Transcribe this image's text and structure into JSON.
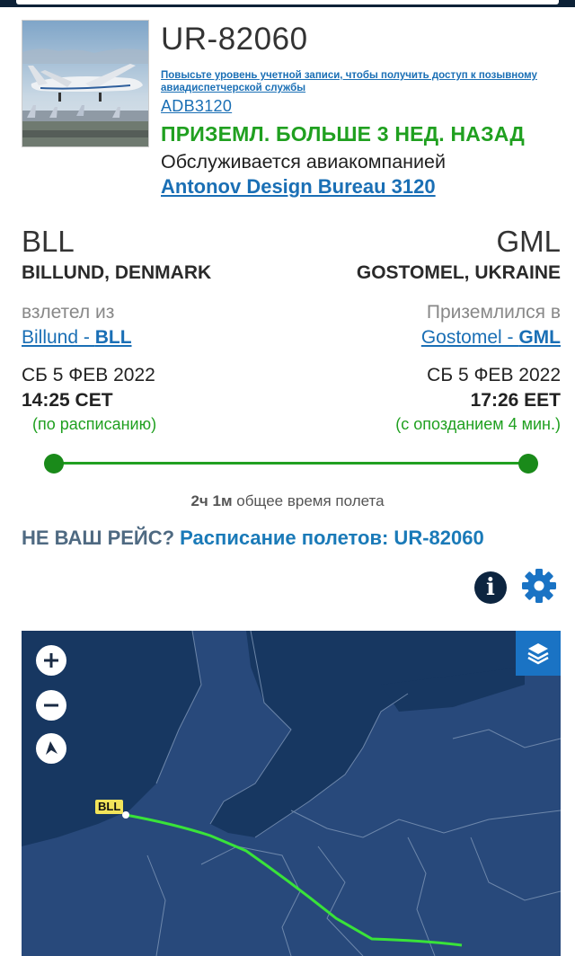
{
  "aircraft": {
    "registration": "UR-82060",
    "upgrade_notice": "Повысьте уровень учетной записи, чтобы получить доступ к позывному авиадиспетчерской службы",
    "callsign": "ADB3120",
    "status": "ПРИЗЕМЛ. БОЛЬШЕ 3 НЕД. НАЗАД",
    "operated_by": "Обслуживается авиакомпанией",
    "airline": "Antonov Design Bureau 3120"
  },
  "origin": {
    "code": "BLL",
    "city": "BILLUND, DENMARK",
    "verb": "взлетел из",
    "link_city": "Billund - ",
    "link_code": "BLL",
    "date": "СБ 5 ФЕВ 2022",
    "time": "14:25 CET",
    "note": "(по расписанию)"
  },
  "destination": {
    "code": "GML",
    "city": "GOSTOMEL, UKRAINE",
    "verb": "Приземлился в",
    "link_city": "Gostomel - ",
    "link_code": "GML",
    "date": "СБ 5 ФЕВ 2022",
    "time": "17:26 EET",
    "note": "(с опозданием 4 мин.)"
  },
  "flight": {
    "duration_value": "2ч 1м",
    "duration_label": " общее время полета",
    "progress": 1.0
  },
  "not_yours": {
    "prefix": "НЕ ВАШ РЕЙС? ",
    "link": "Расписание полетов: UR-82060"
  },
  "icons": {
    "info": "info-icon",
    "settings": "gear-icon",
    "zoom_in": "plus-icon",
    "zoom_out": "minus-icon",
    "compass": "compass-icon",
    "layers": "layers-icon"
  },
  "map": {
    "origin_label": "BLL"
  },
  "colors": {
    "accent": "#1a6fb5",
    "status_green": "#20a020",
    "map_land": "#28497b",
    "map_sea": "#173761",
    "track": "#39e339"
  }
}
